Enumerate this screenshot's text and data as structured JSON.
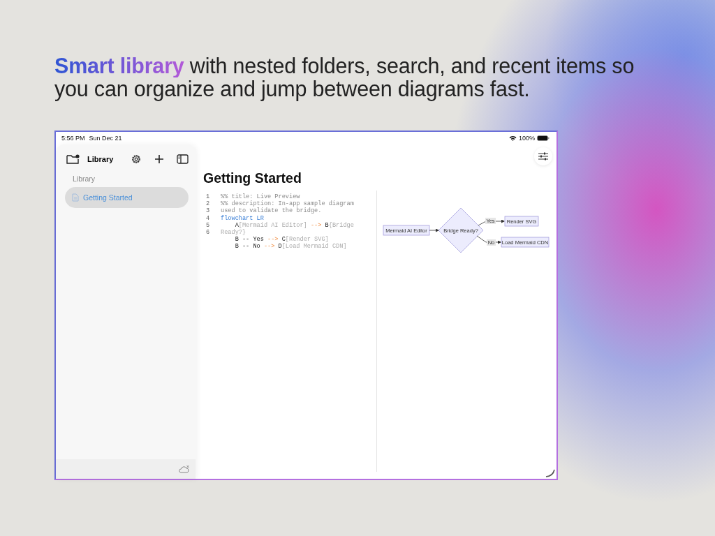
{
  "headline": {
    "highlight": "Smart library",
    "rest": " with nested folders, search, and recent items so you can organize and jump between diagrams fast."
  },
  "status_bar": {
    "time": "5:56 PM",
    "date": "Sun Dec 21",
    "battery": "100%"
  },
  "sidebar": {
    "title": "Library",
    "section": "Library",
    "items": [
      {
        "label": "Getting Started",
        "selected": true
      }
    ]
  },
  "document": {
    "title": "Getting Started",
    "code_lines": [
      {
        "number": "1",
        "segments": [
          {
            "kind": "comment",
            "text": "%% title: Live Preview"
          }
        ]
      },
      {
        "number": "2",
        "segments": [
          {
            "kind": "comment",
            "text": "%% description: In-app sample diagram"
          }
        ]
      },
      {
        "number": "3",
        "segments": [
          {
            "kind": "comment",
            "text": "used to validate the bridge."
          }
        ]
      },
      {
        "number": "4",
        "segments": [
          {
            "kind": "keyword",
            "text": "flowchart LR"
          }
        ]
      },
      {
        "number": "5",
        "segments": [
          {
            "kind": "plain",
            "text": "    A"
          },
          {
            "kind": "label",
            "text": "[Mermaid AI Editor] "
          },
          {
            "kind": "arrow",
            "text": "-->"
          },
          {
            "kind": "plain",
            "text": " B"
          },
          {
            "kind": "label",
            "text": "{Bridge"
          }
        ]
      },
      {
        "number": "6",
        "segments": [
          {
            "kind": "label",
            "text": "Ready?}"
          }
        ]
      },
      {
        "segments": [
          {
            "kind": "plain",
            "text": "    B -- Yes "
          },
          {
            "kind": "arrow",
            "text": "-->"
          },
          {
            "kind": "plain",
            "text": " C"
          },
          {
            "kind": "label",
            "text": "[Render SVG]"
          }
        ]
      },
      {
        "segments": [
          {
            "kind": "plain",
            "text": "    B -- No "
          },
          {
            "kind": "arrow",
            "text": "-->"
          },
          {
            "kind": "plain",
            "text": " D"
          },
          {
            "kind": "label",
            "text": "[Load Mermaid CDN]"
          }
        ]
      }
    ],
    "diagram": {
      "start": "Mermaid AI Editor",
      "decision": "Bridge Ready?",
      "yes_label": "Yes",
      "yes_target": "Render SVG",
      "no_label": "No",
      "no_target": "Load Mermaid CDN"
    }
  }
}
